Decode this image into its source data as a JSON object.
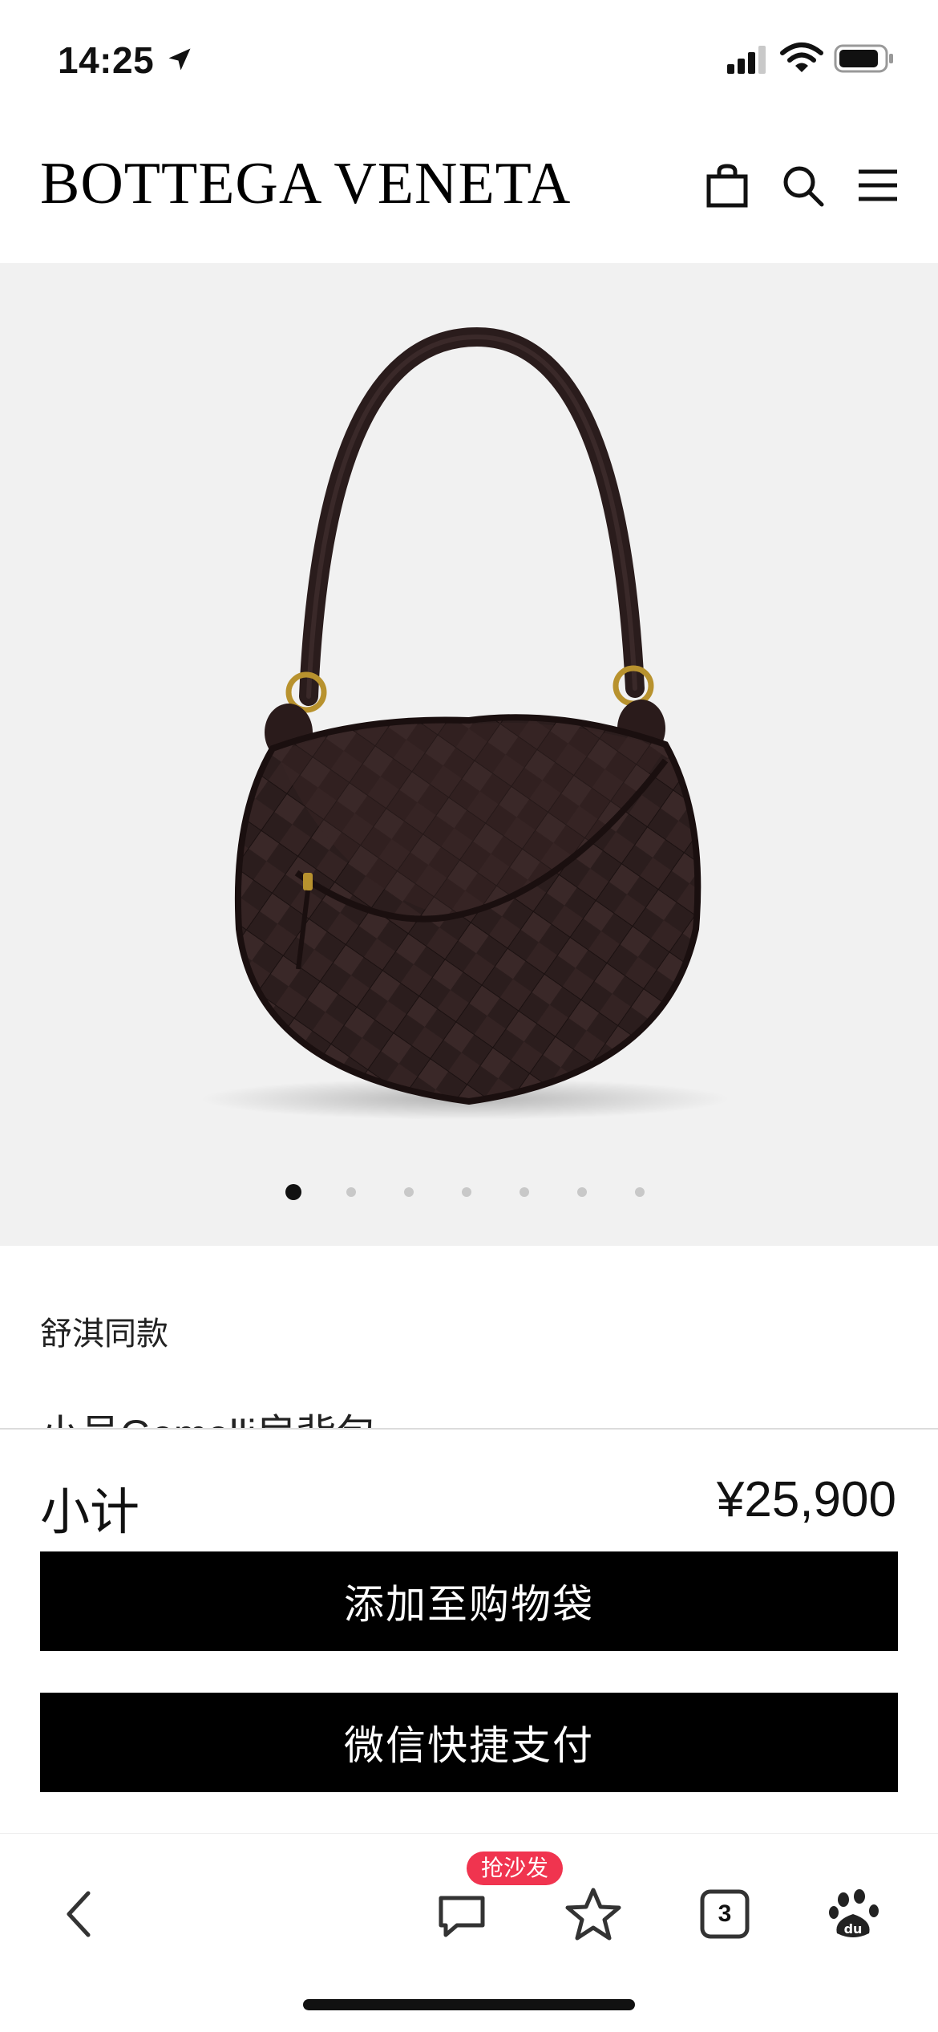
{
  "status_bar": {
    "time": "14:25",
    "icons": [
      "location-arrow-icon",
      "signal-icon",
      "wifi-icon",
      "battery-icon"
    ]
  },
  "header": {
    "brand": "BOTTEGA VENETA",
    "icons": [
      "shopping-bag-icon",
      "search-icon",
      "menu-icon"
    ]
  },
  "gallery": {
    "image_description": "dark brown intrecciato woven leather half-moon shoulder bag",
    "dot_count": 7,
    "active_index": 0
  },
  "product": {
    "tagline": "舒淇同款",
    "name": "小号Gemelli肩背包"
  },
  "purchase": {
    "subtotal_label": "小计",
    "subtotal_value": "¥25,900",
    "add_to_bag": "添加至购物袋",
    "wechat_pay": "微信快捷支付"
  },
  "browser_bar": {
    "comment_badge": "抢沙发",
    "tab_count": "3",
    "icons": [
      "back-icon",
      "comment-icon",
      "star-icon",
      "tabs-icon",
      "baidu-icon"
    ]
  },
  "colors": {
    "accent": "#000000",
    "gallery_bg": "#f1f1f1",
    "badge": "#f0344f",
    "bag": "#2e1f1f"
  }
}
